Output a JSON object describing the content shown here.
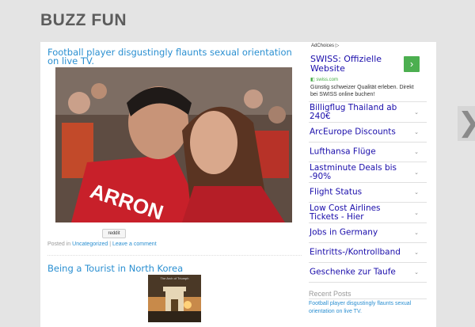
{
  "site": {
    "title": "BUZZ FUN"
  },
  "posts": [
    {
      "title": "Football player disgustingly flaunts sexual orientation on live TV.",
      "reddit_label": "reddit",
      "meta_prefix": "Posted in ",
      "category": "Uncategorized",
      "meta_sep": " | ",
      "comment_link": "Leave a comment"
    },
    {
      "title": "Being a Tourist in North Korea",
      "thumb_caption": "The Arch of Triumph"
    }
  ],
  "ad": {
    "adchoices": "AdChoices",
    "headline": "SWISS: Offizielle Website",
    "url": "swiss.com",
    "description": "Günstig schweizer Qualität erleben. Direkt bei SWISS online buchen!",
    "arrow": "›",
    "links": [
      "Billigflug Thailand ab 240€",
      "ArcEurope Discounts",
      "Lufthansa Flüge",
      "Lastminute Deals bis -90%",
      "Flight Status",
      "Low Cost Airlines Tickets - Hier",
      "Jobs in Germany",
      "Eintritts-/Kontrollband",
      "Geschenke zur Taufe"
    ]
  },
  "sidebar": {
    "recent_heading": "Recent Posts",
    "recent_items": [
      "Football player disgustingly flaunts sexual orientation on live TV."
    ]
  },
  "nav": {
    "next_glyph": "❯"
  },
  "colors": {
    "link": "#2a8fd1",
    "ad_link": "#1a0dab",
    "ad_button": "#4caf50",
    "background": "#e4e4e4"
  }
}
